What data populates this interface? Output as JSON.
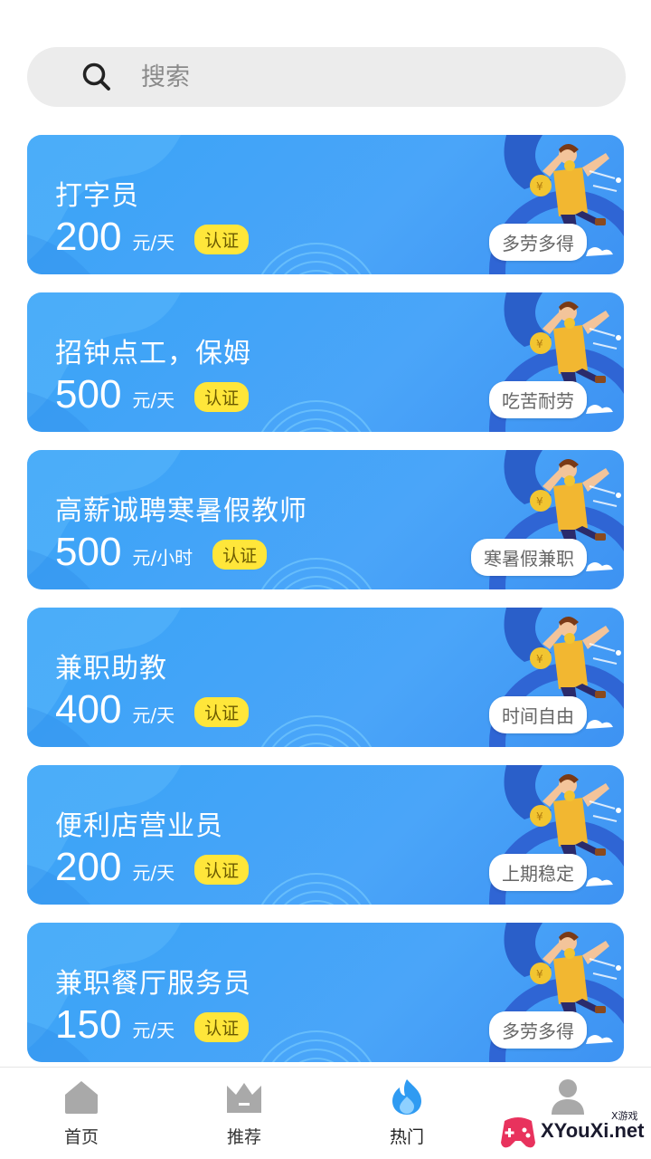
{
  "search": {
    "placeholder": "搜索"
  },
  "jobs": [
    {
      "title": "打字员",
      "amount": "200",
      "unit": "元/天",
      "badge": "认证",
      "tag": "多劳多得"
    },
    {
      "title": "招钟点工，保姆",
      "amount": "500",
      "unit": "元/天",
      "badge": "认证",
      "tag": "吃苦耐劳"
    },
    {
      "title": "高薪诚聘寒暑假教师",
      "amount": "500",
      "unit": "元/小时",
      "badge": "认证",
      "tag": "寒暑假兼职"
    },
    {
      "title": "兼职助教",
      "amount": "400",
      "unit": "元/天",
      "badge": "认证",
      "tag": "时间自由"
    },
    {
      "title": "便利店营业员",
      "amount": "200",
      "unit": "元/天",
      "badge": "认证",
      "tag": "上期稳定"
    },
    {
      "title": "兼职餐厅服务员",
      "amount": "150",
      "unit": "元/天",
      "badge": "认证",
      "tag": "多劳多得"
    }
  ],
  "nav": {
    "items": [
      {
        "label": "首页",
        "icon": "home-icon",
        "active": false
      },
      {
        "label": "推荐",
        "icon": "crown-icon",
        "active": false
      },
      {
        "label": "热门",
        "icon": "flame-icon",
        "active": true
      },
      {
        "label": "",
        "icon": "user-icon",
        "active": false
      }
    ]
  },
  "watermark": {
    "text": "XYouXi.net",
    "small": "X游戏"
  },
  "colors": {
    "card_blue": "#44a4f8",
    "badge_yellow": "#ffe63a",
    "active_blue": "#2f9bf2",
    "inactive_gray": "#a9a9a9"
  }
}
